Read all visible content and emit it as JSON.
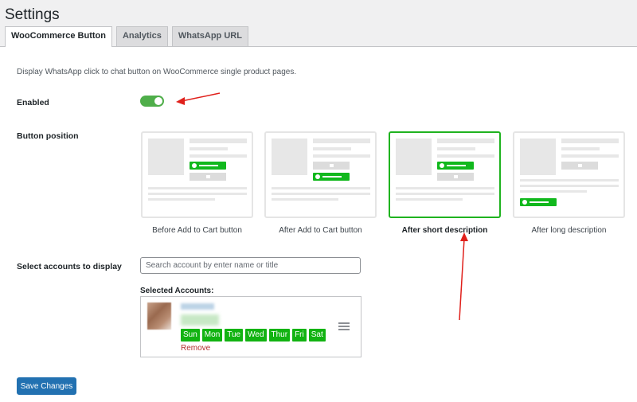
{
  "page": {
    "title": "Settings"
  },
  "tabs": [
    {
      "label": "WooCommerce Button",
      "active": true
    },
    {
      "label": "Analytics",
      "active": false
    },
    {
      "label": "WhatsApp URL",
      "active": false
    }
  ],
  "description": "Display WhatsApp click to chat button on WooCommerce single product pages.",
  "enabled": {
    "label": "Enabled",
    "value": true
  },
  "button_position": {
    "label": "Button position",
    "options": [
      {
        "label": "Before Add to Cart button",
        "selected": false
      },
      {
        "label": "After Add to Cart button",
        "selected": false
      },
      {
        "label": "After short description",
        "selected": true
      },
      {
        "label": "After long description",
        "selected": false
      }
    ]
  },
  "accounts": {
    "label": "Select accounts to display",
    "search_placeholder": "Search account by enter name or title",
    "selected_title": "Selected Accounts:",
    "days": [
      "Sun",
      "Mon",
      "Tue",
      "Wed",
      "Thur",
      "Fri",
      "Sat"
    ],
    "remove_label": "Remove"
  },
  "save_button": "Save Changes",
  "colors": {
    "accent": "#2271b1",
    "whatsapp_green": "#12b312",
    "annotation_red": "#e0201b",
    "remove_red": "#b32d2e"
  }
}
